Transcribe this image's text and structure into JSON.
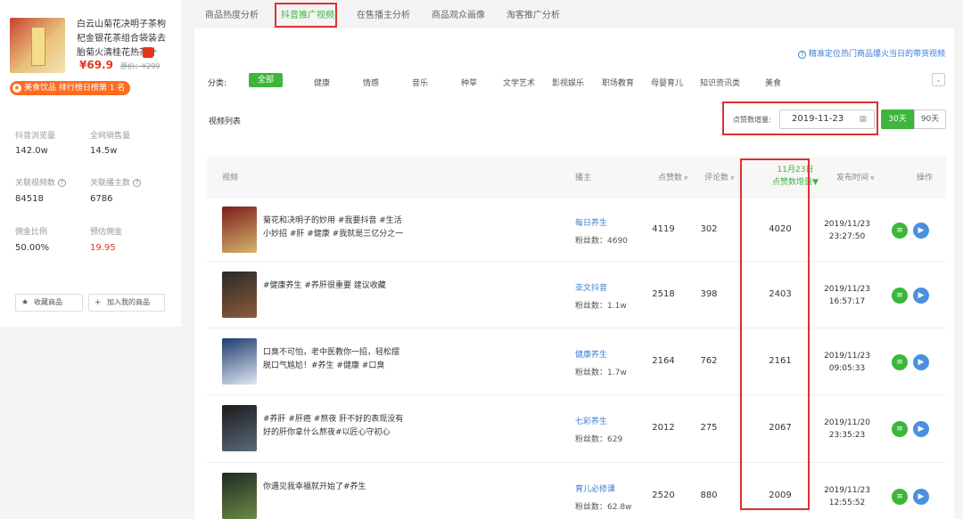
{
  "product": {
    "title": "白云山菊花决明子茶枸杞金银花茶组合袋装去胎菊火清桂花热茶叶",
    "price": "¥69.9",
    "old_price": "原价：¥299",
    "rank_badge": "美食饮品 排行榜日榜第 1 名",
    "stats": [
      {
        "label": "抖音浏览量",
        "value": "142.0w"
      },
      {
        "label": "全网销售量",
        "value": "14.5w"
      },
      {
        "label": "关联视频数",
        "value": "84518"
      },
      {
        "label": "关联播主数",
        "value": "6786"
      },
      {
        "label": "佣金比例",
        "value": "50.00%"
      },
      {
        "label": "预估佣金",
        "value": "19.95"
      }
    ],
    "btn_collect": "收藏商品",
    "btn_add": "加入我的商品"
  },
  "tabs": [
    "商品热度分析",
    "抖音推广视频",
    "在售播主分析",
    "商品观众画像",
    "淘客推广分析"
  ],
  "hint": "精准定位热门商品爆火当日的带货视频",
  "categories": {
    "label": "分类:",
    "items": [
      "全部",
      "健康",
      "情感",
      "音乐",
      "种草",
      "文学艺术",
      "影视娱乐",
      "职场教育",
      "母婴育儿",
      "知识资讯类",
      "美食"
    ]
  },
  "list_title": "视频列表",
  "date_filter": {
    "label": "点赞数增量:",
    "value": "2019-11-23",
    "btn_30": "30天",
    "btn_90": "90天"
  },
  "table": {
    "headers": {
      "video": "视频",
      "author": "播主",
      "likes": "点赞数",
      "comments": "评论数",
      "increment_date": "11月23日",
      "increment_label": "点赞数增量",
      "publish": "发布时间",
      "ops": "操作"
    },
    "rows": [
      {
        "desc": "菊花和决明子的妙用 #我要抖音 #生活小妙招 #肝 #健康 #我就是三亿分之一",
        "author": "每日养生",
        "fans": "粉丝数：4690",
        "likes": "4119",
        "comments": "302",
        "increment": "4020",
        "date": "2019/11/23",
        "time": "23:27:50"
      },
      {
        "desc": "#健康养生 #养肝很重要 建议收藏",
        "author": "亚文抖音",
        "fans": "粉丝数：1.1w",
        "likes": "2518",
        "comments": "398",
        "increment": "2403",
        "date": "2019/11/23",
        "time": "16:57:17"
      },
      {
        "desc": "口臭不可怕，老中医教你一招，轻松摆脱口气尴尬！#养生 #健康 #口臭",
        "author": "健康养生",
        "fans": "粉丝数：1.7w",
        "likes": "2164",
        "comments": "762",
        "increment": "2161",
        "date": "2019/11/23",
        "time": "09:05:33"
      },
      {
        "desc": "#养肝 #肝癌 #熬夜 肝不好的表现没有好的肝你拿什么熬夜#以匠心守初心",
        "author": "七彩养生",
        "fans": "粉丝数：629",
        "likes": "2012",
        "comments": "275",
        "increment": "2067",
        "date": "2019/11/20",
        "time": "23:35:23"
      },
      {
        "desc": "你遇见我幸福就开始了#养生",
        "author": "育儿必修课",
        "fans": "粉丝数：62.8w",
        "likes": "2520",
        "comments": "880",
        "increment": "2009",
        "date": "2019/11/23",
        "time": "12:55:52"
      }
    ]
  },
  "colors": {
    "accent": "#3db63b",
    "highlight": "#e03030",
    "link": "#3a7dd6",
    "price": "#e8341d"
  }
}
